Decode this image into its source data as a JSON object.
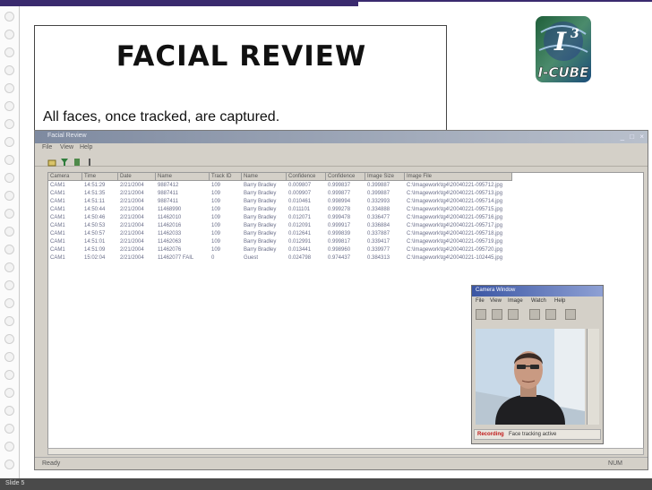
{
  "slide": {
    "title": "FACIAL REVIEW",
    "subtitle": "All faces, once tracked, are captured.",
    "footer": "Slide 5",
    "logo_text_top": "I",
    "logo_text_sup": "3",
    "logo_text_bottom": "I-CUBE"
  },
  "app": {
    "title": "Facial Review",
    "controls": "_ □ ×",
    "menu": [
      "File",
      "View",
      "Help"
    ],
    "toolbar_icons": [
      "open-icon",
      "filter-icon",
      "export-icon"
    ],
    "columns": [
      "Camera",
      "Time",
      "Date",
      "Name",
      "Track ID",
      "Name",
      "Confidence",
      "Confidence",
      "Image Size",
      "Image File"
    ],
    "rows": [
      [
        "CAM1",
        "14:51:29",
        "2/21/2004",
        "9887412",
        "109",
        "Barry Bradley",
        "0.009807",
        "0.999837",
        "0.399887",
        "C:\\Imagework\\tg4\\20040221-095712.jpg"
      ],
      [
        "CAM1",
        "14:51:35",
        "2/21/2004",
        "9887411",
        "109",
        "Barry Bradley",
        "0.009907",
        "0.999877",
        "0.399887",
        "C:\\Imagework\\tg4\\20040221-095713.jpg"
      ],
      [
        "CAM1",
        "14:51:11",
        "2/21/2004",
        "9887411",
        "109",
        "Barry Bradley",
        "0.010461",
        "0.998994",
        "0.332993",
        "C:\\Imagework\\tg4\\20040221-095714.jpg"
      ],
      [
        "CAM1",
        "14:50:44",
        "2/21/2004",
        "11468990",
        "109",
        "Barry Bradley",
        "0.011101",
        "0.999278",
        "0.334888",
        "C:\\Imagework\\tg4\\20040221-095715.jpg"
      ],
      [
        "CAM1",
        "14:50:46",
        "2/21/2004",
        "11462010",
        "109",
        "Barry Bradley",
        "0.012071",
        "0.999478",
        "0.336477",
        "C:\\Imagework\\tg4\\20040221-095716.jpg"
      ],
      [
        "CAM1",
        "14:50:53",
        "2/21/2004",
        "11462016",
        "109",
        "Barry Bradley",
        "0.012091",
        "0.999917",
        "0.336884",
        "C:\\Imagework\\tg4\\20040221-095717.jpg"
      ],
      [
        "CAM1",
        "14:50:57",
        "2/21/2004",
        "11462033",
        "109",
        "Barry Bradley",
        "0.012641",
        "0.999839",
        "0.337887",
        "C:\\Imagework\\tg4\\20040221-095718.jpg"
      ],
      [
        "CAM1",
        "14:51:01",
        "2/21/2004",
        "11462063",
        "109",
        "Barry Bradley",
        "0.012991",
        "0.999817",
        "0.339417",
        "C:\\Imagework\\tg4\\20040221-095719.jpg"
      ],
      [
        "CAM1",
        "14:51:09",
        "2/21/2004",
        "11462076",
        "109",
        "Barry Bradley",
        "0.013441",
        "0.998960",
        "0.339977",
        "C:\\Imagework\\tg4\\20040221-095720.jpg"
      ],
      [
        "CAM1",
        "15:02:04",
        "2/21/2004",
        "11462077 FAIL",
        "0",
        "Guest",
        "0.024798",
        "0.974437",
        "0.384313",
        "C:\\Imagework\\tg4\\20040221-102445.jpg"
      ]
    ],
    "status_left": "Ready",
    "status_right": "NUM"
  },
  "camera": {
    "title": "Camera Window",
    "menu": [
      "File",
      "View",
      "Image",
      "Watch",
      "Help"
    ],
    "status_label": "Recording",
    "status_text": "Face tracking active",
    "colors": {
      "status": "#c01818",
      "titlebar": "#3b56a4"
    }
  }
}
